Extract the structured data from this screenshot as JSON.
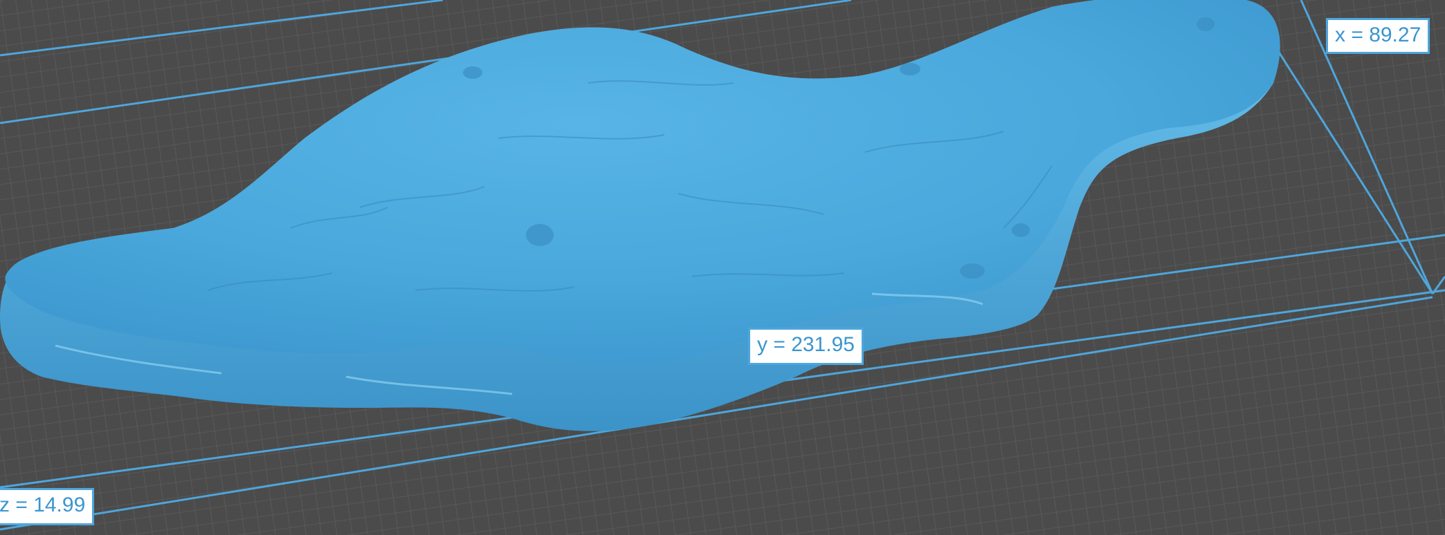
{
  "viewport": {
    "background_color": "#4b4b4b",
    "grid_color": "#5e5e5e",
    "bounding_box_color": "#4ea6dc",
    "model_color": "#4aa9dd"
  },
  "dimensions": {
    "x_label": "x = 89.27",
    "y_label": "y = 231.95",
    "z_label": "z = 14.99"
  }
}
